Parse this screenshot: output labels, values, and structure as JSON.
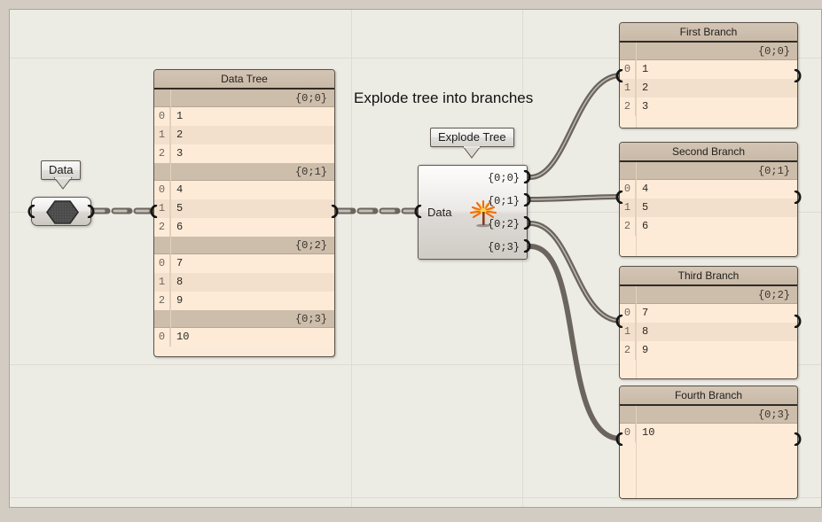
{
  "canvas": {
    "background_color": "#ecebe4",
    "grid_color": "#dedbd2",
    "frame_color": "#a9a49c",
    "outer_color": "#d3ccc3"
  },
  "annotation": {
    "text": "Explode tree into branches"
  },
  "param_node": {
    "name": "Data",
    "label": "Data",
    "icon": "hexagon-icon"
  },
  "data_tree_panel": {
    "title": "Data Tree",
    "branches": [
      {
        "path": "{0;0}",
        "rows": [
          {
            "index": "0",
            "value": "1"
          },
          {
            "index": "1",
            "value": "2"
          },
          {
            "index": "2",
            "value": "3"
          }
        ]
      },
      {
        "path": "{0;1}",
        "rows": [
          {
            "index": "0",
            "value": "4"
          },
          {
            "index": "1",
            "value": "5"
          },
          {
            "index": "2",
            "value": "6"
          }
        ]
      },
      {
        "path": "{0;2}",
        "rows": [
          {
            "index": "0",
            "value": "7"
          },
          {
            "index": "1",
            "value": "8"
          },
          {
            "index": "2",
            "value": "9"
          }
        ]
      },
      {
        "path": "{0;3}",
        "rows": [
          {
            "index": "0",
            "value": "10"
          }
        ]
      }
    ]
  },
  "explode_component": {
    "bubble_label": "Explode Tree",
    "input_label": "Data",
    "icon": "palm-tree-icon",
    "outputs": [
      {
        "label": "{0;0}"
      },
      {
        "label": "{0;1}"
      },
      {
        "label": "{0;2}"
      },
      {
        "label": "{0;3}"
      }
    ]
  },
  "branch_panels": [
    {
      "title": "First Branch",
      "path": "{0;0}",
      "rows": [
        {
          "index": "0",
          "value": "1"
        },
        {
          "index": "1",
          "value": "2"
        },
        {
          "index": "2",
          "value": "3"
        }
      ]
    },
    {
      "title": "Second Branch",
      "path": "{0;1}",
      "rows": [
        {
          "index": "0",
          "value": "4"
        },
        {
          "index": "1",
          "value": "5"
        },
        {
          "index": "2",
          "value": "6"
        }
      ]
    },
    {
      "title": "Third Branch",
      "path": "{0;2}",
      "rows": [
        {
          "index": "0",
          "value": "7"
        },
        {
          "index": "1",
          "value": "8"
        },
        {
          "index": "2",
          "value": "9"
        }
      ]
    },
    {
      "title": "Fourth Branch",
      "path": "{0;3}",
      "rows": [
        {
          "index": "0",
          "value": "10"
        }
      ]
    }
  ],
  "colors": {
    "panel_title_bg": "#cdbdab",
    "branch_header_bg": "#cdbdab",
    "row_light": "#fdebd8",
    "row_alt": "#f3e0cc",
    "wire_color": "#6b655d",
    "wire_highlight": "#b7b2aa",
    "icon_accent": "#f47b16"
  }
}
